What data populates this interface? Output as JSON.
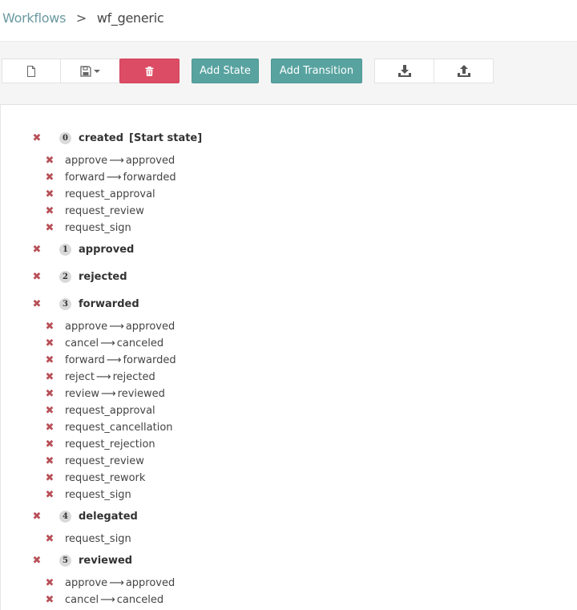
{
  "breadcrumb": {
    "root": "Workflows",
    "separator": ">",
    "current": "wf_generic"
  },
  "toolbar": {
    "add_state": "Add State",
    "add_transition": "Add Transition"
  },
  "colors": {
    "accent": "#58a3a0",
    "danger": "#dc4c64",
    "delete_mark": "#b85058"
  },
  "states": [
    {
      "index": "0",
      "name": "created",
      "note": "[Start state]",
      "transitions": [
        {
          "label": "approve",
          "target": "approved"
        },
        {
          "label": "forward",
          "target": "forwarded"
        },
        {
          "label": "request_approval",
          "target": ""
        },
        {
          "label": "request_review",
          "target": ""
        },
        {
          "label": "request_sign",
          "target": ""
        }
      ]
    },
    {
      "index": "1",
      "name": "approved",
      "note": "",
      "transitions": []
    },
    {
      "index": "2",
      "name": "rejected",
      "note": "",
      "transitions": []
    },
    {
      "index": "3",
      "name": "forwarded",
      "note": "",
      "transitions": [
        {
          "label": "approve",
          "target": "approved"
        },
        {
          "label": "cancel",
          "target": "canceled"
        },
        {
          "label": "forward",
          "target": "forwarded"
        },
        {
          "label": "reject",
          "target": "rejected"
        },
        {
          "label": "review",
          "target": "reviewed"
        },
        {
          "label": "request_approval",
          "target": ""
        },
        {
          "label": "request_cancellation",
          "target": ""
        },
        {
          "label": "request_rejection",
          "target": ""
        },
        {
          "label": "request_review",
          "target": ""
        },
        {
          "label": "request_rework",
          "target": ""
        },
        {
          "label": "request_sign",
          "target": ""
        }
      ]
    },
    {
      "index": "4",
      "name": "delegated",
      "note": "",
      "transitions": [
        {
          "label": "request_sign",
          "target": ""
        }
      ]
    },
    {
      "index": "5",
      "name": "reviewed",
      "note": "",
      "transitions": [
        {
          "label": "approve",
          "target": "approved"
        },
        {
          "label": "cancel",
          "target": "canceled"
        }
      ]
    }
  ]
}
